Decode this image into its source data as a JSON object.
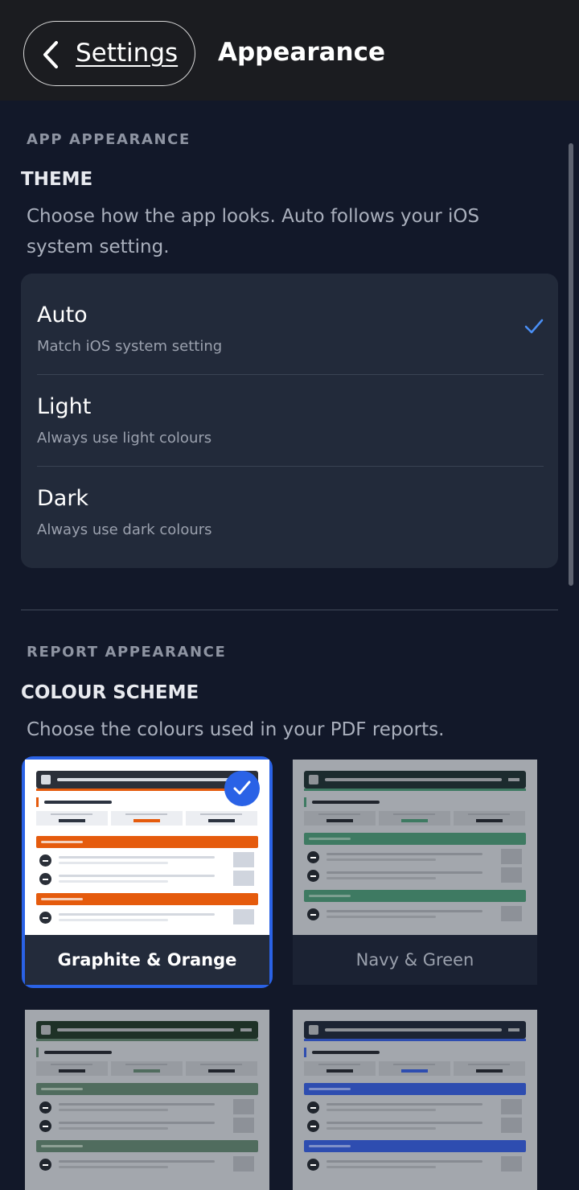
{
  "nav": {
    "back_label": "Settings",
    "title": "Appearance"
  },
  "app_appearance": {
    "section_label": "APP APPEARANCE",
    "heading": "THEME",
    "description": "Choose how the app looks. Auto follows your iOS system setting.",
    "options": [
      {
        "title": "Auto",
        "subtitle": "Match iOS system setting",
        "selected": true
      },
      {
        "title": "Light",
        "subtitle": "Always use light colours",
        "selected": false
      },
      {
        "title": "Dark",
        "subtitle": "Always use dark colours",
        "selected": false
      }
    ]
  },
  "report_appearance": {
    "section_label": "REPORT APPEARANCE",
    "heading": "COLOUR SCHEME",
    "description": "Choose the colours used in your PDF reports.",
    "schemes": [
      {
        "name": "Graphite & Orange",
        "selected": true,
        "header_color": "#2b3039",
        "accent_color": "#e55b0d"
      },
      {
        "name": "Navy & Green",
        "selected": false,
        "header_color": "#1c2b2e",
        "accent_color": "#3e7a62"
      },
      {
        "name": "",
        "selected": false,
        "header_color": "#1e3127",
        "accent_color": "#506c5e"
      },
      {
        "name": "",
        "selected": false,
        "header_color": "#1c2433",
        "accent_color": "#2e4db0"
      }
    ]
  },
  "icons": {
    "back": "chevron-left-icon",
    "selected_check": "checkmark-icon"
  },
  "colors": {
    "accent": "#2a62e6",
    "background": "#121829",
    "card": "#222a3a"
  }
}
